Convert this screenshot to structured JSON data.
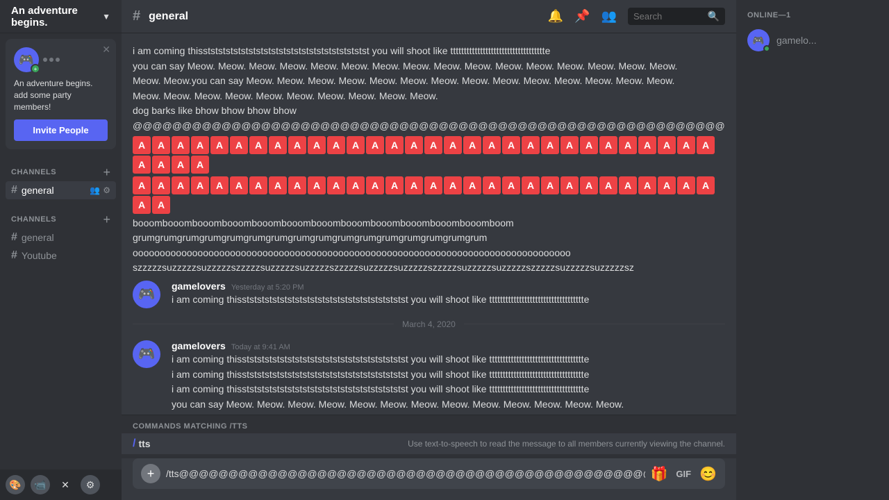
{
  "sidebar": {
    "server_chevron": "▼",
    "party_popup": {
      "text_line1": "An adventure begins.",
      "text_line2": "add some party members!",
      "invite_button": "Invite People"
    },
    "text_channels_label": "CHANNELS",
    "channels": [
      {
        "name": "general",
        "active": true
      },
      {
        "name": "general",
        "active": false
      },
      {
        "name": "Youtube",
        "active": false
      }
    ],
    "voice_channels_label": "CHANNELS",
    "bottom_icons": [
      {
        "icon": "🎨",
        "label": "paintbrush-icon"
      },
      {
        "icon": "📹",
        "label": "video-icon"
      },
      {
        "icon": "✕",
        "label": "close-icon"
      },
      {
        "icon": "⚙",
        "label": "settings-icon"
      }
    ]
  },
  "channel": {
    "name": "general",
    "header_icons": {
      "bell": "🔔",
      "pin": "📌",
      "members": "👥"
    },
    "search_placeholder": "Search"
  },
  "messages": [
    {
      "id": "msg-top-1",
      "text_lines": [
        "i am coming thisstststststststststststststststststststststst you will shoot like ttttttttttttttttttttttttttttttttttte",
        "you can say Meow. Meow. Meow. Meow. Meow. Meow. Meow. Meow. Meow. Meow. Meow. Meow. Meow. Meow. Meow. Meow.",
        "Meow. Meow.you can say Meow. Meow. Meow. Meow. Meow. Meow. Meow. Meow. Meow. Meow. Meow. Meow. Meow. Meow.",
        "Meow. Meow. Meow. Meow. Meow. Meow. Meow. Meow. Meow. Meow.",
        "dog barks like bhow bhow bhow bhow",
        "@@@@@@@@@@@@@@@@@@@@@@@@@@@@@@@@@@@@@@@@@@@@@@@@@@@@@@@@@@@@",
        "booombooombooombooombooombooombooombooombooombooombooombooomboom",
        "grumgrumgrumgrumgrumgrumgrumgrumgrumgrumgrumgrumgrumgrumgrumgrum",
        "ooooooooooooooooooooooooooooooooooooooooooooooooooooooooooooooooooooooooooooooooo",
        "szzzzzsuzzzzzsuzzzzzszzzzzsuzzzzzsuzzzzzszzzzzsuzzzzzsuzzzzzszzzzzsuzzzzzsuzzzzzszzzzzsuzzzzzsuzzzzzsz"
      ],
      "has_letter_blocks": true,
      "letter_blocks_row1": [
        "A",
        "A",
        "A",
        "A",
        "A",
        "A",
        "A",
        "A",
        "A",
        "A",
        "A",
        "A",
        "A",
        "A",
        "A",
        "A",
        "A",
        "A",
        "A",
        "A",
        "A",
        "A",
        "A",
        "A",
        "A",
        "A",
        "A",
        "A",
        "A",
        "A",
        "A",
        "A",
        "A",
        "A"
      ],
      "letter_blocks_row2": [
        "A",
        "A",
        "A",
        "A",
        "A",
        "A",
        "A",
        "A",
        "A",
        "A",
        "A",
        "A",
        "A",
        "A",
        "A",
        "A",
        "A",
        "A",
        "A",
        "A",
        "A",
        "A",
        "A",
        "A",
        "A",
        "A",
        "A",
        "A",
        "A",
        "A",
        "A",
        "A"
      ]
    },
    {
      "id": "msg-gamelovers-1",
      "username": "gamelovers",
      "timestamp": "Yesterday at 5:20 PM",
      "text_lines": [
        "i am coming thisstststststststststststststststststststststst you will shoot like ttttttttttttttttttttttttttttttttttte"
      ]
    },
    {
      "id": "date-sep",
      "type": "separator",
      "text": "March 4, 2020"
    },
    {
      "id": "msg-gamelovers-2",
      "username": "gamelovers",
      "timestamp": "Today at 9:41 AM",
      "text_lines": [
        "i am coming thisstststststststststststststststststststststst you will shoot like ttttttttttttttttttttttttttttttttttte",
        "i am coming thisstststststststststststststststststststststst you will shoot like ttttttttttttttttttttttttttttttttttte",
        "i am coming thisstststststststststststststststststststststst you will shoot like ttttttttttttttttttttttttttttttttttte",
        "you can say Meow. Meow. Meow. Meow. Meow. Meow. Meow. Meow. Meow. Meow. Meow. Meow. Meow."
      ]
    }
  ],
  "commands": {
    "header": "COMMANDS MATCHING",
    "query": "/tts",
    "items": [
      {
        "slash": "/",
        "name": "tts",
        "description": "Use text-to-speech to read the message to all members currently viewing the channel."
      }
    ]
  },
  "input": {
    "value": "/tts@@@@@@@@@@@@@@@@@@@@@@@@@@@@@@@@@@@@@@@@@@@@@@@@@@@@@@@@@@@@",
    "add_icon": "+",
    "icons": {
      "gift": "🎁",
      "gif": "GIF",
      "emoji": "😊"
    }
  },
  "right_sidebar": {
    "online_label": "ONLINE—1",
    "members": [
      {
        "name": "gamelo...",
        "status": "online"
      }
    ]
  }
}
